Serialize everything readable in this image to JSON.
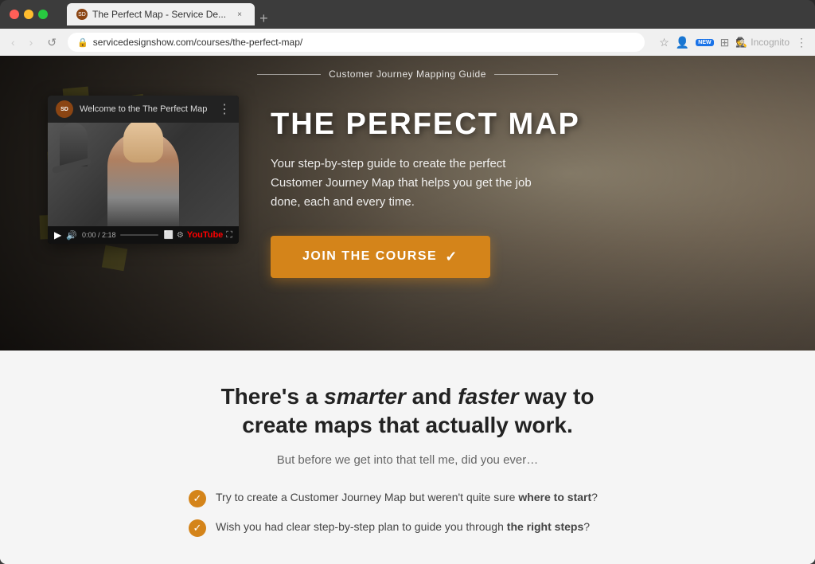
{
  "browser": {
    "tab_title": "The Perfect Map - Service De...",
    "tab_close": "×",
    "new_tab_icon": "+",
    "address": "servicedesignshow.com/courses/the-perfect-map/",
    "back_btn": "‹",
    "forward_btn": "›",
    "refresh_btn": "↺",
    "incognito_label": "Incognito",
    "new_badge": "NEW"
  },
  "hero": {
    "breadcrumb": "Customer Journey Mapping Guide",
    "title": "THE PERFECT MAP",
    "subtitle": "Your step-by-step guide to create the perfect Customer Journey Map that helps you get the job done, each and every time.",
    "cta_label": "JOIN THE COURSE",
    "cta_check": "✓",
    "video_logo_text": "SD",
    "video_title": "Welcome to the The Perfect Map",
    "video_time": "0:00 / 2:18",
    "youtube_label": "YouTube"
  },
  "section": {
    "tagline_part1": "There's a ",
    "tagline_italic1": "smarter",
    "tagline_part2": " and ",
    "tagline_italic2": "faster",
    "tagline_part3": " way to",
    "tagline_line2": "create maps that actually work.",
    "subtitle": "But before we get into that tell me, did you ever…",
    "checklist": [
      {
        "text_before": "Try to create a Customer Journey Map but weren't quite sure ",
        "text_bold": "where to start",
        "text_after": "?"
      },
      {
        "text_before": "Wish you had clear step-by-step plan to guide you through ",
        "text_bold": "the right steps",
        "text_after": "?"
      }
    ]
  }
}
